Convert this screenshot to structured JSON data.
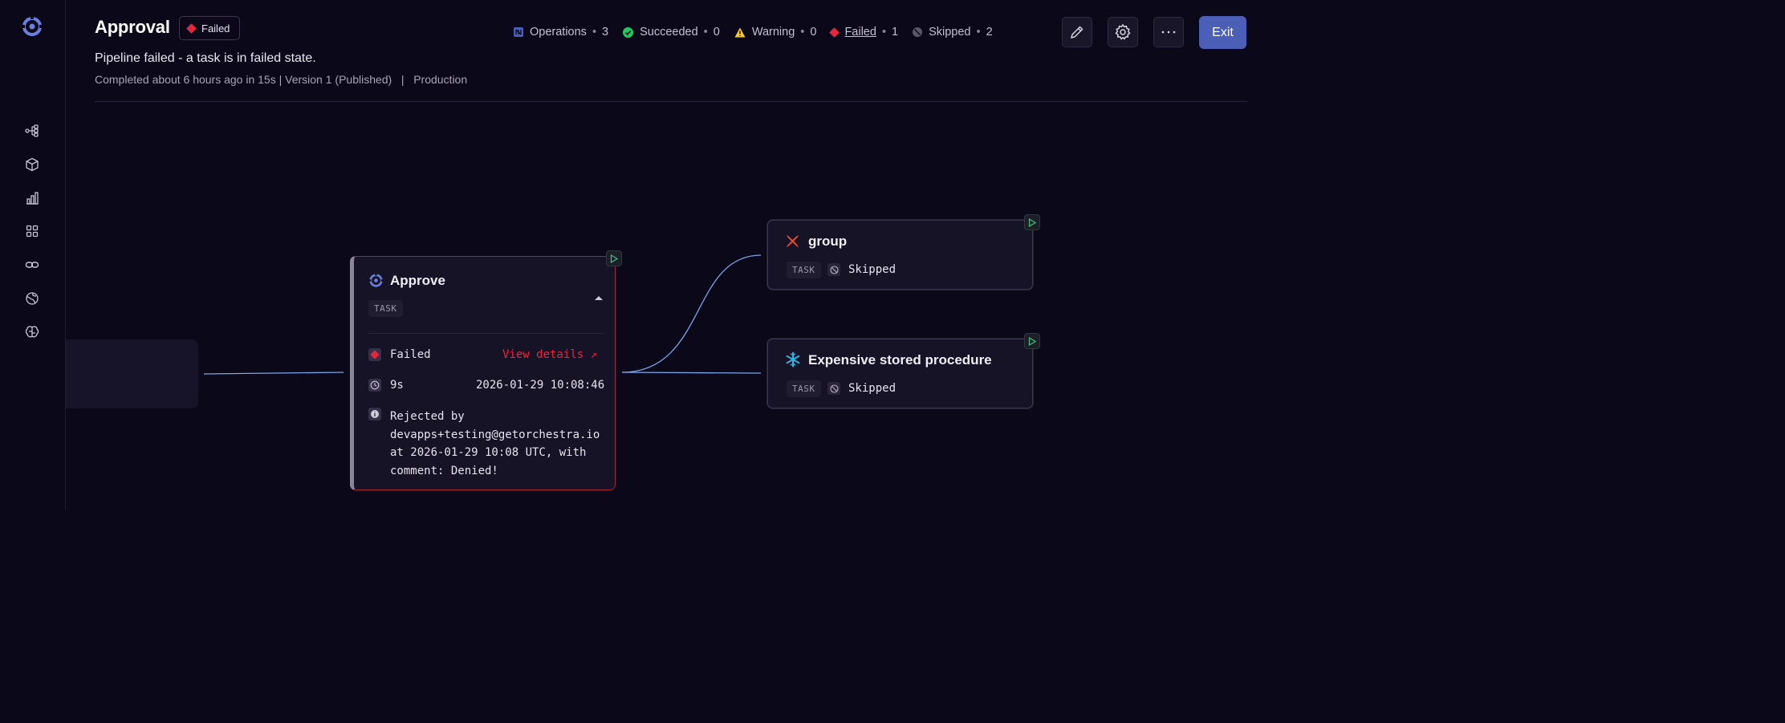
{
  "header": {
    "title": "Approval",
    "status_badge": "Failed",
    "subtitle": "Pipeline failed - a task is in failed state.",
    "meta_completed": "Completed about 6 hours ago in 15s",
    "meta_version": "Version 1 (Published)",
    "meta_env": "Production",
    "exit_label": "Exit"
  },
  "stats": [
    {
      "label": "Operations",
      "count": "3"
    },
    {
      "label": "Succeeded",
      "count": "0"
    },
    {
      "label": "Warning",
      "count": "0"
    },
    {
      "label": "Failed",
      "count": "1"
    },
    {
      "label": "Skipped",
      "count": "2"
    }
  ],
  "sidebar": {
    "icons": [
      "pipelines-icon",
      "package-icon",
      "bar-chart-icon",
      "grid-icon",
      "link-icon",
      "globe-icon",
      "brain-icon"
    ]
  },
  "approve_card": {
    "title": "Approve",
    "type_chip": "TASK",
    "status": "Failed",
    "view_details": "View details",
    "view_details_arrow": "↗",
    "duration": "9s",
    "timestamp": "2026-01-29 10:08:46",
    "info_lines": [
      "Rejected by",
      "devapps+testing@getorchestra.io",
      "at 2026-01-29 10:08 UTC, with",
      "comment: Denied!"
    ]
  },
  "group_card": {
    "title": "group",
    "type_chip": "TASK",
    "status": "Skipped"
  },
  "procedure_card": {
    "title": "Expensive stored procedure",
    "type_chip": "TASK",
    "status": "Skipped"
  },
  "colors": {
    "background": "#0b0819",
    "accent": "#4a5fb5",
    "failed": "#e5273d",
    "success": "#22c55e",
    "warning": "#facc15",
    "edge": "#7aa6ea"
  }
}
